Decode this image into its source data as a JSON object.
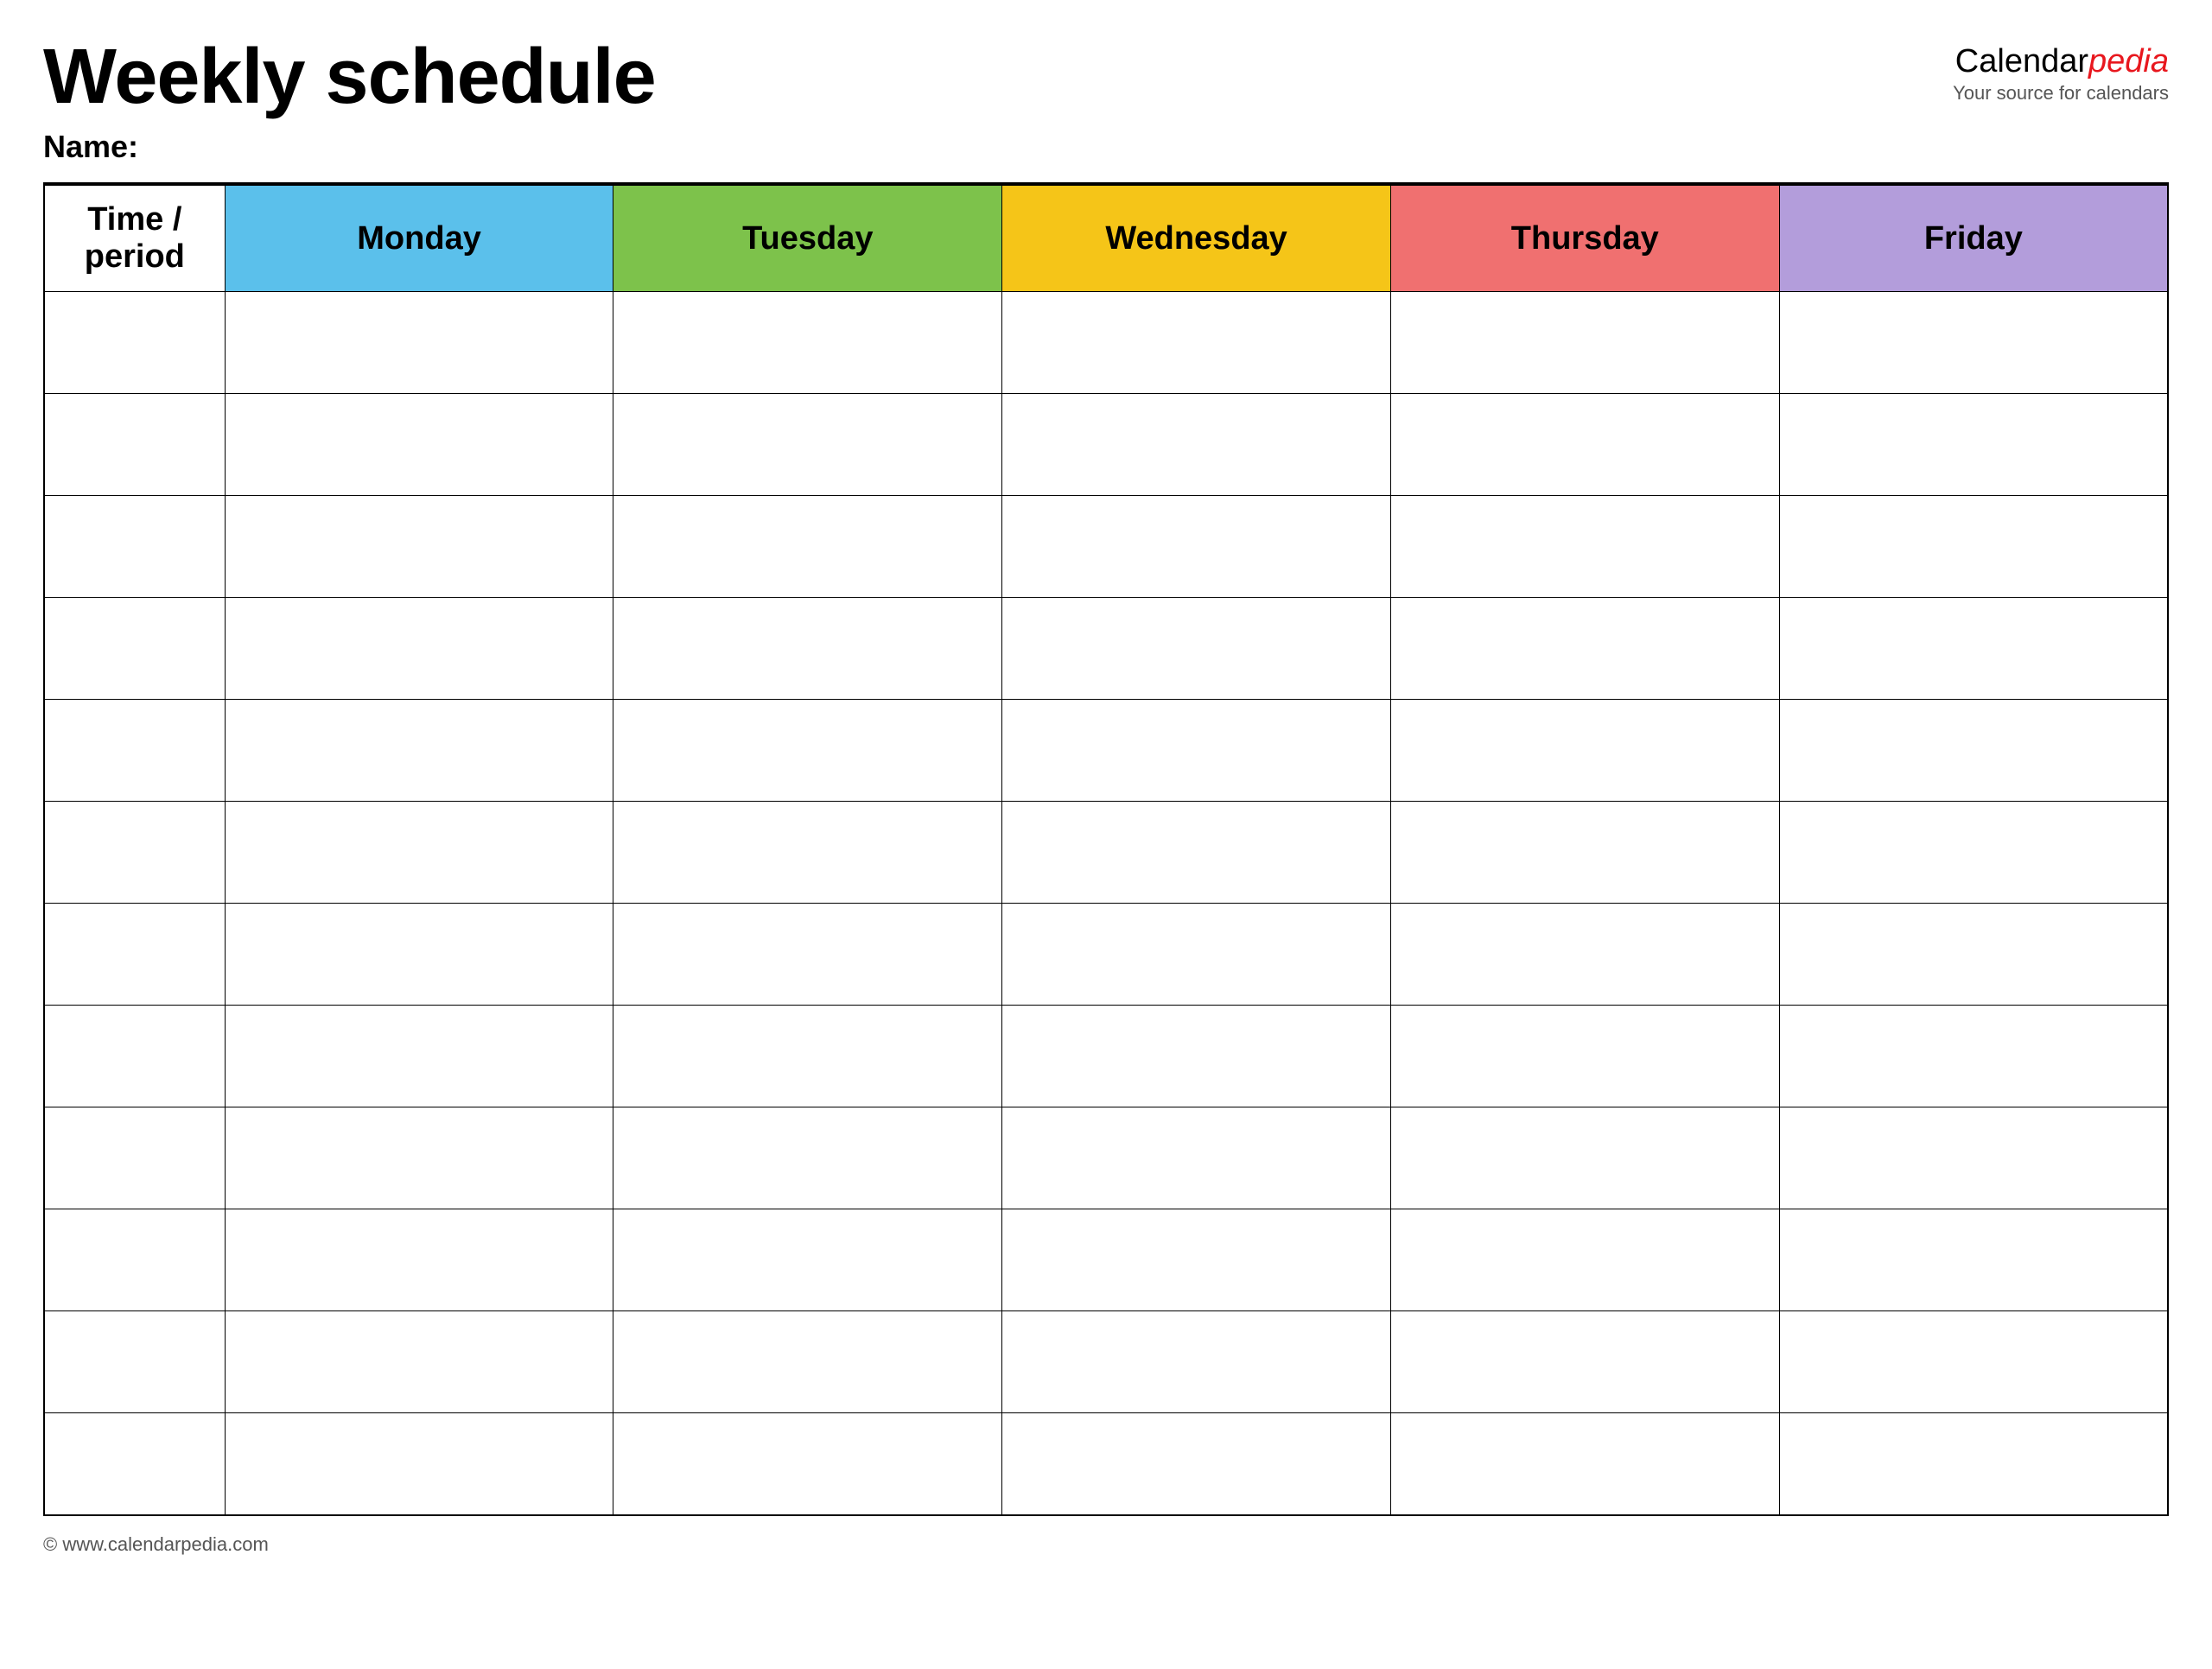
{
  "header": {
    "title": "Weekly schedule",
    "name_label": "Name:",
    "logo_calendar": "Calendar",
    "logo_pedia": "pedia",
    "logo_tagline": "Your source for calendars"
  },
  "table": {
    "columns": [
      {
        "key": "time",
        "label": "Time / period",
        "color": "#ffffff"
      },
      {
        "key": "monday",
        "label": "Monday",
        "color": "#5bc0eb"
      },
      {
        "key": "tuesday",
        "label": "Tuesday",
        "color": "#7dc24b"
      },
      {
        "key": "wednesday",
        "label": "Wednesday",
        "color": "#f5c518"
      },
      {
        "key": "thursday",
        "label": "Thursday",
        "color": "#f07070"
      },
      {
        "key": "friday",
        "label": "Friday",
        "color": "#b39ddb"
      }
    ],
    "row_count": 12
  },
  "footer": {
    "url": "© www.calendarpedia.com"
  }
}
